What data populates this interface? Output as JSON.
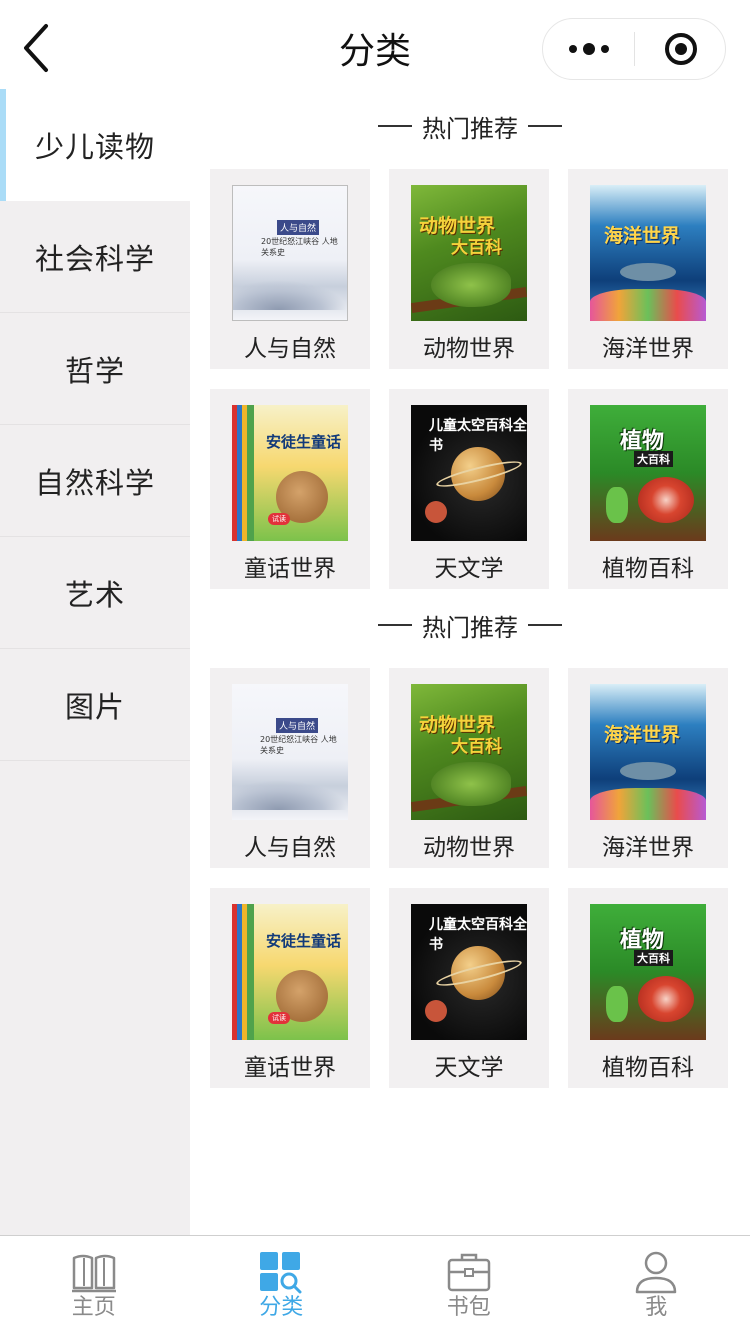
{
  "nav": {
    "title": "分类"
  },
  "sidebar": {
    "items": [
      {
        "label": "少儿读物",
        "active": true
      },
      {
        "label": "社会科学",
        "active": false
      },
      {
        "label": "哲学",
        "active": false
      },
      {
        "label": "自然科学",
        "active": false
      },
      {
        "label": "艺术",
        "active": false
      },
      {
        "label": "图片",
        "active": false
      }
    ]
  },
  "sections": [
    {
      "title": "热门推荐",
      "books": [
        {
          "label": "人与自然",
          "cover": {
            "tag": "人与自然",
            "subtitle": "20世纪怒江峡谷 人地关系史"
          }
        },
        {
          "label": "动物世界",
          "cover": {
            "title": "动物世界",
            "title2": "大百科"
          }
        },
        {
          "label": "海洋世界",
          "cover": {
            "title": "海洋世界"
          }
        },
        {
          "label": "童话世界",
          "cover": {
            "title": "安徒生童话",
            "button": "试读"
          }
        },
        {
          "label": "天文学",
          "cover": {
            "title": "儿童太空百科全书"
          }
        },
        {
          "label": "植物百科",
          "cover": {
            "title": "植物",
            "title2": "大百科"
          }
        }
      ]
    },
    {
      "title": "热门推荐",
      "books": [
        {
          "label": "人与自然",
          "cover": {
            "tag": "人与自然",
            "subtitle": "20世纪怒江峡谷 人地关系史"
          }
        },
        {
          "label": "动物世界",
          "cover": {
            "title": "动物世界",
            "title2": "大百科"
          }
        },
        {
          "label": "海洋世界",
          "cover": {
            "title": "海洋世界"
          }
        },
        {
          "label": "童话世界",
          "cover": {
            "title": "安徒生童话",
            "button": "试读"
          }
        },
        {
          "label": "天文学",
          "cover": {
            "title": "儿童太空百科全书"
          }
        },
        {
          "label": "植物百科",
          "cover": {
            "title": "植物",
            "title2": "大百科"
          }
        }
      ]
    }
  ],
  "tabbar": {
    "tabs": [
      {
        "label": "主页",
        "icon": "book-icon",
        "active": false
      },
      {
        "label": "分类",
        "icon": "category-icon",
        "active": true
      },
      {
        "label": "书包",
        "icon": "bag-icon",
        "active": false
      },
      {
        "label": "我",
        "icon": "user-icon",
        "active": false
      }
    ]
  },
  "colors": {
    "accent": "#3fa8e6",
    "sidebar_bg": "#f1eff0",
    "active_bar": "#aadcf7"
  }
}
